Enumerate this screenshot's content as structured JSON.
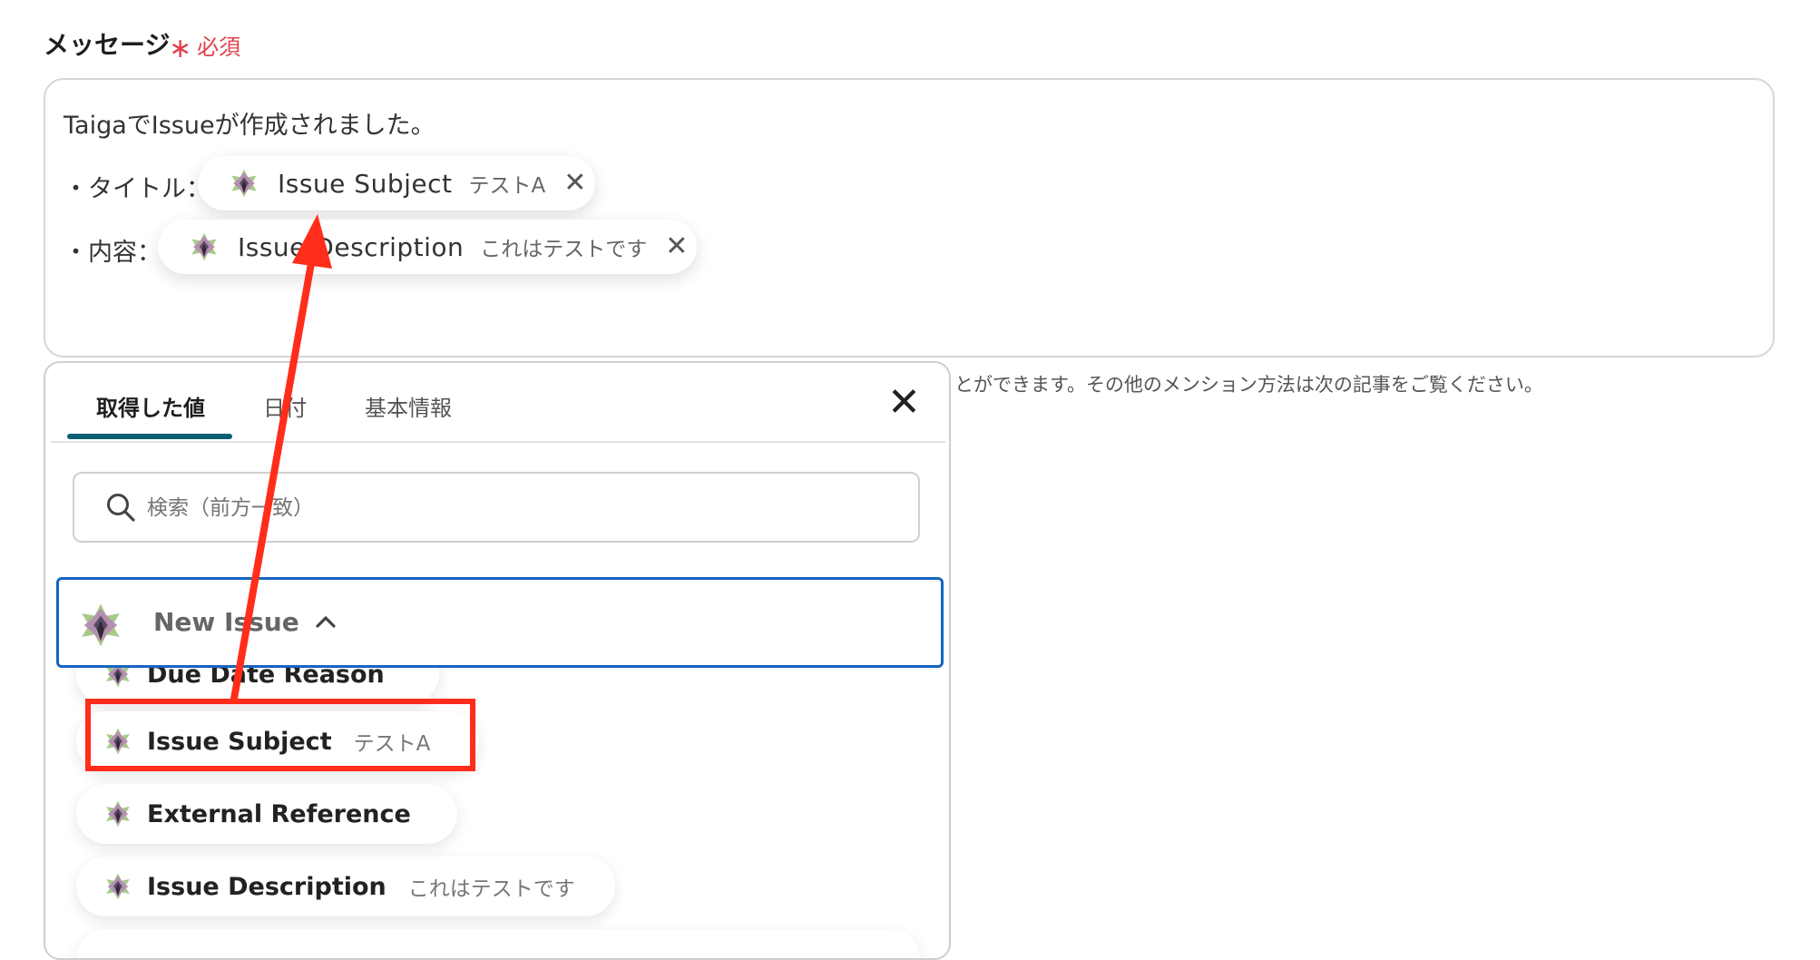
{
  "field": {
    "label": "メッセージ",
    "required_label": "必須"
  },
  "editor": {
    "line1": "TaigaでIssueが作成されました。",
    "line2_prefix": "・タイトル：",
    "line3_prefix": "・内容：",
    "pill_title": {
      "name": "Issue Subject",
      "value": "テストA"
    },
    "pill_content": {
      "name": "Issue Description",
      "value": "これはテストです"
    }
  },
  "hint": "とができます。その他のメンション方法は次の記事をご覧ください。",
  "panel": {
    "tabs": [
      "取得した値",
      "日付",
      "基本情報"
    ],
    "active_tab": 0,
    "search_placeholder": "検索（前方一致）",
    "group": {
      "label": "New Issue"
    },
    "items": [
      {
        "name": "Due Date Reason",
        "value": ""
      },
      {
        "name": "Issue Subject",
        "value": "テストA"
      },
      {
        "name": "External Reference",
        "value": ""
      },
      {
        "name": "Issue Description",
        "value": "これはテストです"
      }
    ]
  },
  "colors": {
    "required": "#e0414f",
    "tab_underline": "#0b5f73",
    "group_border": "#1565c0",
    "annotation_red": "#ff2d1a"
  },
  "icons": {
    "taiga": "taiga-logo-icon",
    "close": "close-icon",
    "search": "search-icon",
    "chevron": "chevron-up-icon"
  }
}
